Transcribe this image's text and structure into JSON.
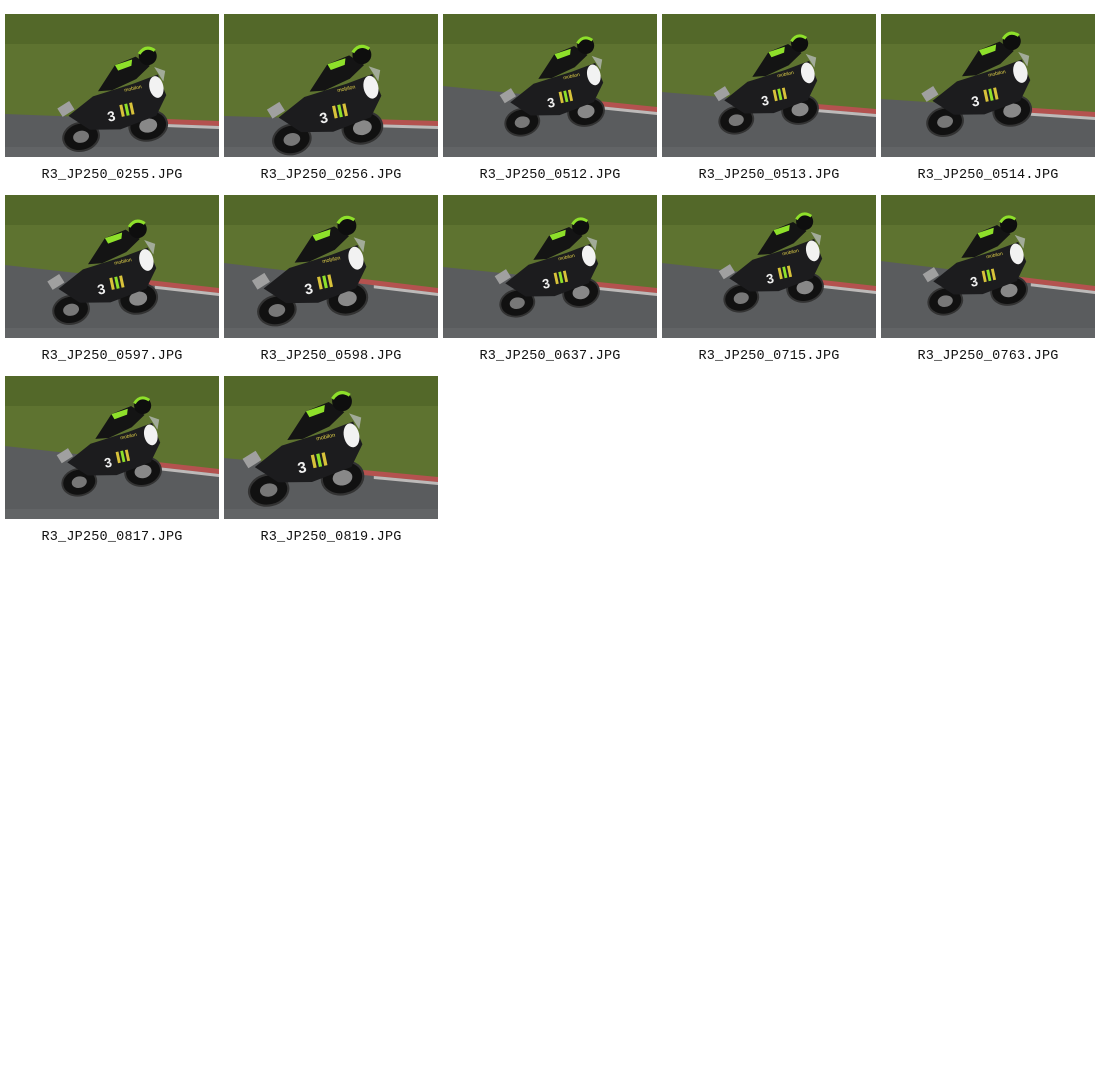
{
  "gallery": {
    "photos": [
      {
        "filename": "R3_JP250_0255.JPG",
        "variant": 0
      },
      {
        "filename": "R3_JP250_0256.JPG",
        "variant": 1
      },
      {
        "filename": "R3_JP250_0512.JPG",
        "variant": 2
      },
      {
        "filename": "R3_JP250_0513.JPG",
        "variant": 3
      },
      {
        "filename": "R3_JP250_0514.JPG",
        "variant": 4
      },
      {
        "filename": "R3_JP250_0597.JPG",
        "variant": 5
      },
      {
        "filename": "R3_JP250_0598.JPG",
        "variant": 6
      },
      {
        "filename": "R3_JP250_0637.JPG",
        "variant": 7
      },
      {
        "filename": "R3_JP250_0715.JPG",
        "variant": 8
      },
      {
        "filename": "R3_JP250_0763.JPG",
        "variant": 9
      },
      {
        "filename": "R3_JP250_0817.JPG",
        "variant": 10
      },
      {
        "filename": "R3_JP250_0819.JPG",
        "variant": 11
      }
    ],
    "photo_subject": {
      "number_plate": "3",
      "sponsor_text": "mobilon"
    }
  },
  "colors": {
    "grass": "#5e7330",
    "grass_dark": "#485a22",
    "asphalt": "#5a5c5e",
    "asphalt_light": "#7a7c7e",
    "curb_red": "#b4524f",
    "curb_white": "#d6d2d0",
    "bike_body": "#1c1c1e",
    "accent_green": "#8ee02a",
    "helmet_white": "#e8e8e8"
  }
}
